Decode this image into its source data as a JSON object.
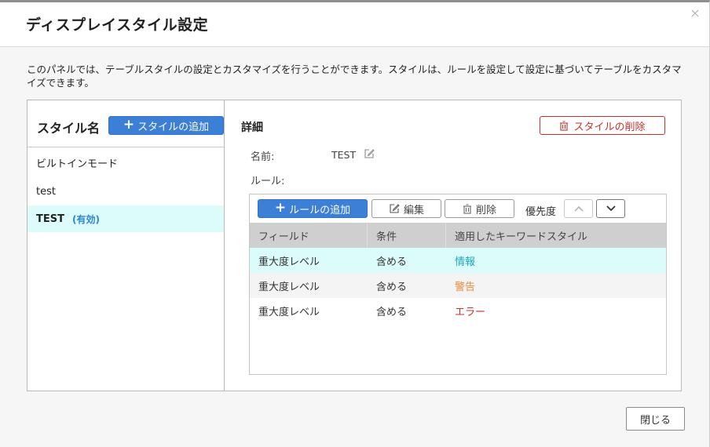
{
  "dialog": {
    "title": "ディスプレイスタイル設定",
    "description": "このパネルでは、テーブルスタイルの設定とカスタマイズを行うことができます。スタイルは、ルールを設定して設定に基づいてテーブルをカスタマイズできます。",
    "close_label": "閉じる"
  },
  "styles_panel": {
    "title": "スタイル名",
    "add_button": "スタイルの追加",
    "items": [
      {
        "label": "ビルトインモード",
        "badge": ""
      },
      {
        "label": "test",
        "badge": ""
      },
      {
        "label": "TEST",
        "badge": "(有効)"
      }
    ]
  },
  "details": {
    "title": "詳細",
    "delete_button": "スタイルの削除",
    "name_label": "名前:",
    "name_value": "TEST",
    "rules_label": "ルール:",
    "toolbar": {
      "add_rule": "ルールの追加",
      "edit": "編集",
      "delete": "削除",
      "priority": "優先度"
    },
    "table": {
      "headers": [
        "フィールド",
        "条件",
        "適用したキーワードスタイル"
      ],
      "rows": [
        {
          "field": "重大度レベル",
          "condition": "含める",
          "style": "情報",
          "style_color": "#1aa9b8"
        },
        {
          "field": "重大度レベル",
          "condition": "含める",
          "style": "警告",
          "style_color": "#ef8a36"
        },
        {
          "field": "重大度レベル",
          "condition": "含める",
          "style": "エラー",
          "style_color": "#c5302c"
        }
      ]
    }
  },
  "colors": {
    "primary": "#3c7fd6",
    "danger": "#c6312e",
    "selected_row": "#dcfbfb"
  }
}
